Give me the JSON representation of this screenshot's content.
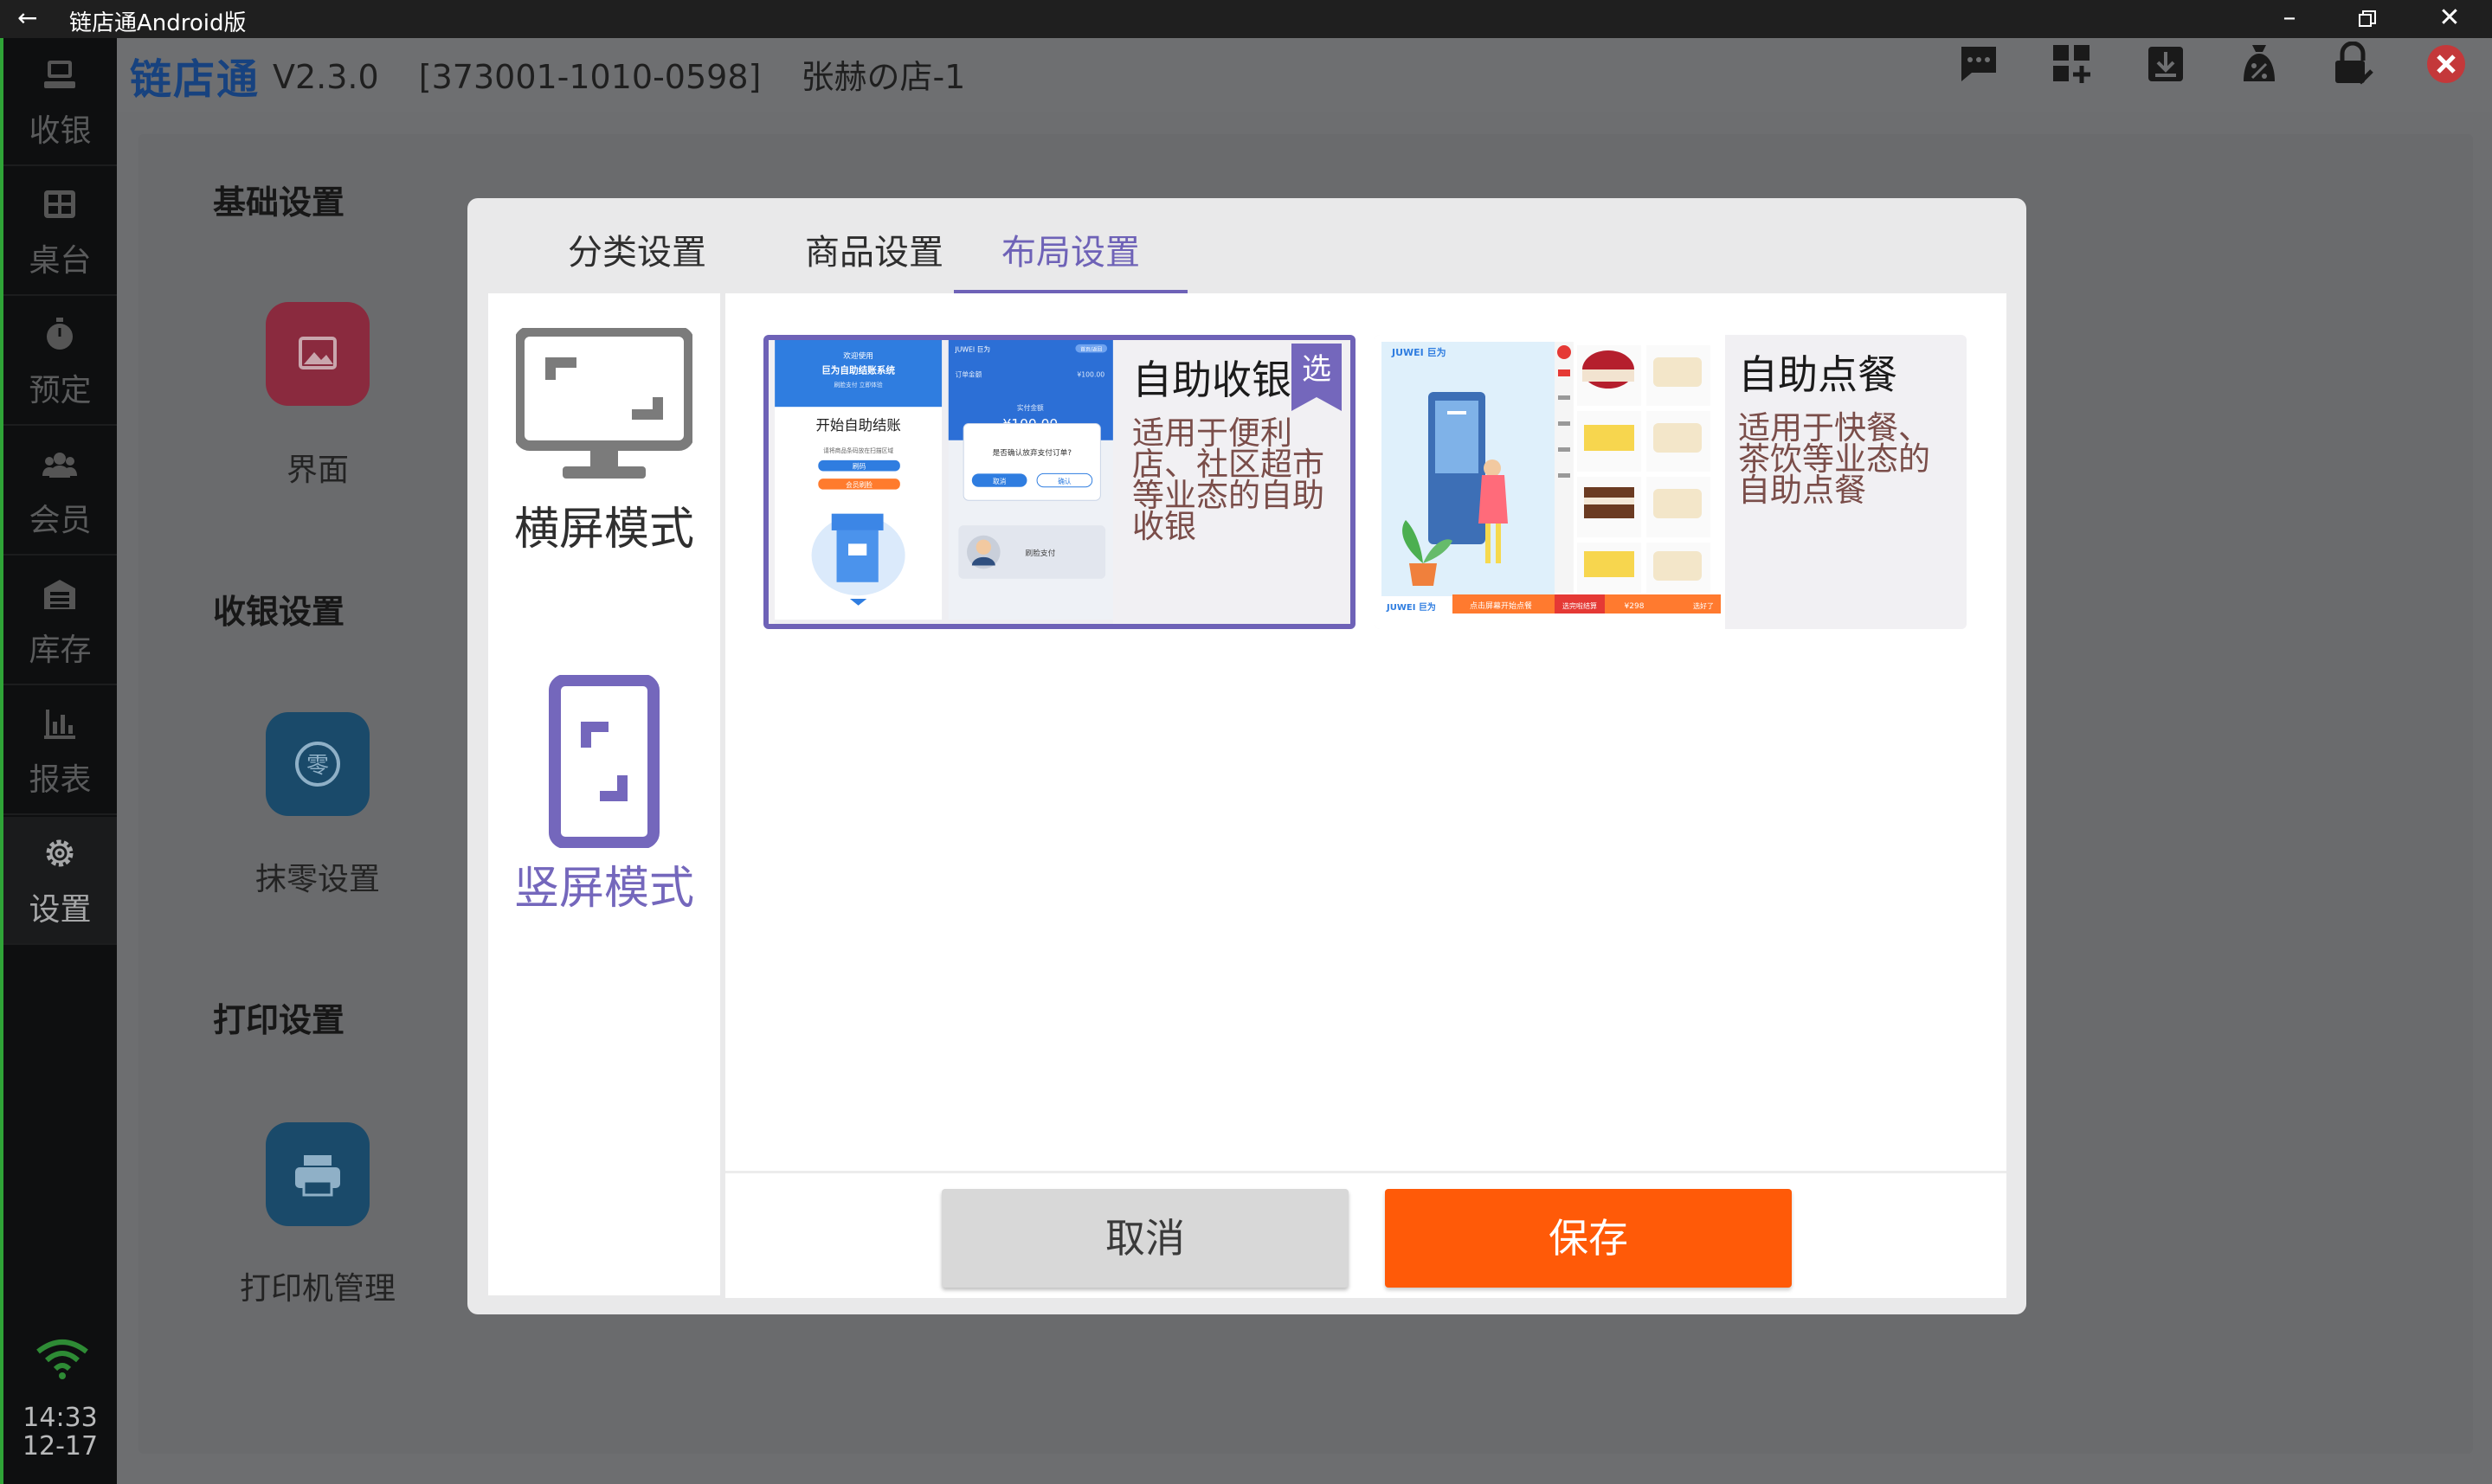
{
  "window": {
    "title": "链店通Android版",
    "back_icon": "arrow-left-icon"
  },
  "app": {
    "brand": "链店通",
    "version": "V2.3.0",
    "device_id": "[373001-1010-0598]",
    "store_name": "张赫の店-1"
  },
  "nav": {
    "items": [
      {
        "label": "收银",
        "icon": "cash-register-icon"
      },
      {
        "label": "桌台",
        "icon": "table-grid-icon"
      },
      {
        "label": "预定",
        "icon": "stopwatch-icon"
      },
      {
        "label": "会员",
        "icon": "members-icon"
      },
      {
        "label": "库存",
        "icon": "warehouse-icon"
      },
      {
        "label": "报表",
        "icon": "bar-chart-icon"
      },
      {
        "label": "设置",
        "icon": "gear-icon",
        "active": true
      }
    ],
    "time": "14:33",
    "date": "12-17"
  },
  "settings": {
    "sections": [
      {
        "title": "基础设置",
        "items": [
          {
            "label": "界面",
            "icon": "image-icon"
          }
        ]
      },
      {
        "title": "收银设置",
        "items": [
          {
            "label": "抹零设置",
            "icon": "round-off-icon"
          }
        ]
      },
      {
        "title": "打印设置",
        "items": [
          {
            "label": "打印机管理",
            "icon": "printer-icon"
          }
        ]
      }
    ]
  },
  "dialog": {
    "tabs": [
      {
        "label": "分类设置",
        "active": false
      },
      {
        "label": "商品设置",
        "active": false
      },
      {
        "label": "布局设置",
        "active": true
      }
    ],
    "modes": [
      {
        "label": "横屏模式",
        "active": false
      },
      {
        "label": "竖屏模式",
        "active": true
      }
    ],
    "layouts": [
      {
        "title": "自助收银",
        "description": "适用于便利店、社区超市等业态的自助收银",
        "selected": true,
        "badge": "选",
        "preview": {
          "welcome": "欢迎使用",
          "system": "巨为自助结账系统",
          "sub": "刷脸支付 立即体验",
          "start": "开始自助结账",
          "hint": "请将商品条码放在扫描区域",
          "btn1": "刷码",
          "btn2": "会员刷脸",
          "brand": "JUWEI 巨为",
          "tag": "首页/返回",
          "order_label": "订单金额",
          "order_amt": "¥100.00",
          "pay_label": "实付金额",
          "amount": "¥100.00",
          "confirm": "是否确认放弃支付订单?",
          "cancel": "取消",
          "ok": "确认",
          "face_pay": "刷脸支付"
        }
      },
      {
        "title": "自助点餐",
        "description": "适用于快餐、茶饮等业态的自助点餐",
        "selected": false,
        "preview": {
          "brand": "JUWEI 巨为",
          "banner": "点击屏幕开始点餐",
          "footer": "选完啦结算",
          "price": "¥298",
          "checkout": "选好了"
        }
      }
    ],
    "cancel_label": "取消",
    "save_label": "保存"
  },
  "toolbar": [
    {
      "icon": "message-icon"
    },
    {
      "icon": "add-widget-icon"
    },
    {
      "icon": "download-icon"
    },
    {
      "icon": "discount-bag-icon"
    },
    {
      "icon": "lock-check-icon"
    },
    {
      "icon": "close-circle-icon"
    }
  ],
  "colors": {
    "accent": "#6e62b7",
    "primary_button": "#ff5a08",
    "brand": "#17427f",
    "active_nav_border": "#2fa437"
  }
}
